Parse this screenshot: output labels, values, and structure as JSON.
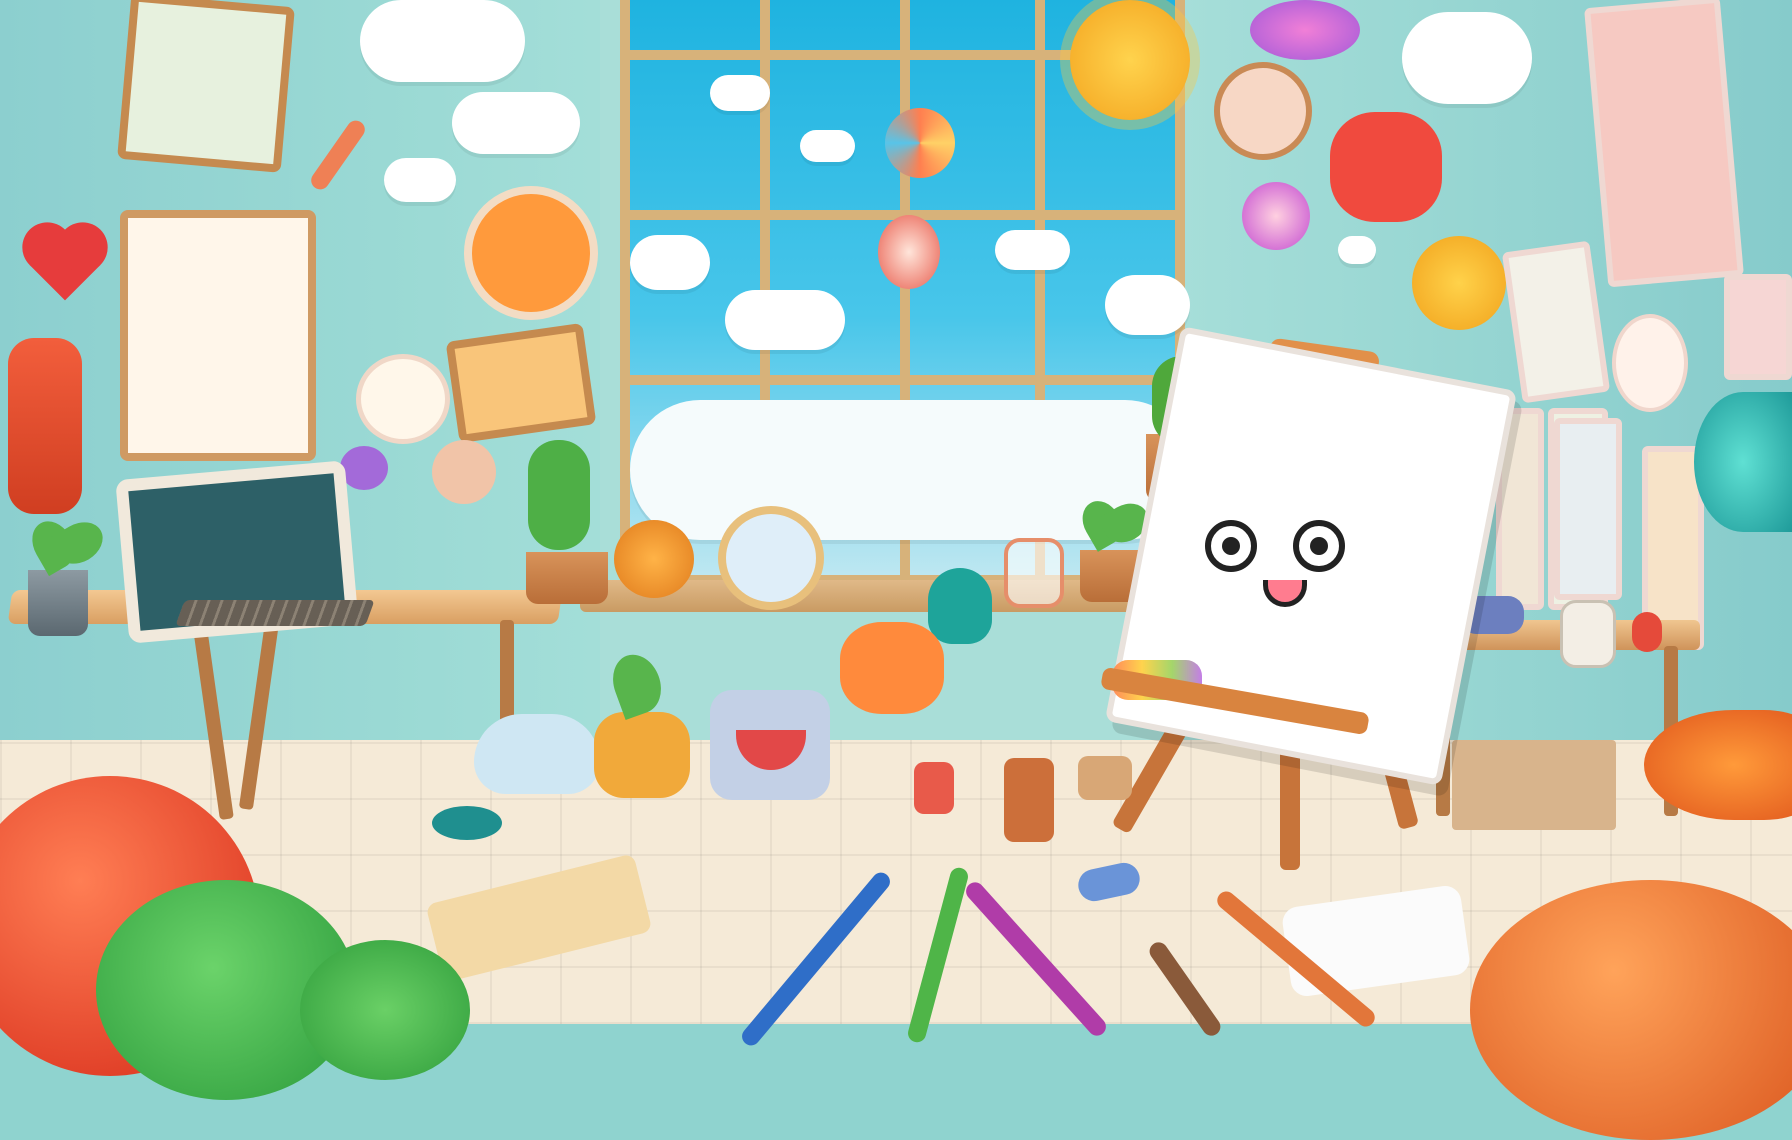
{
  "scene": {
    "type": "cartoon illustration",
    "colors": {
      "wall": "#8fd3cf",
      "sky": "#1fb3e0",
      "floor": "#f5ead7",
      "wood": "#d7b27a",
      "easel": "#c7743a"
    },
    "icons": [
      "smiling-cloud-icon",
      "sun-face-icon",
      "heart-icon",
      "balloon-icon",
      "glasses-face-icon",
      "pencil-icon",
      "paintbrush-icon",
      "plant-icon",
      "monitor-icon",
      "easel-icon"
    ],
    "potted_plant_count": 6
  }
}
